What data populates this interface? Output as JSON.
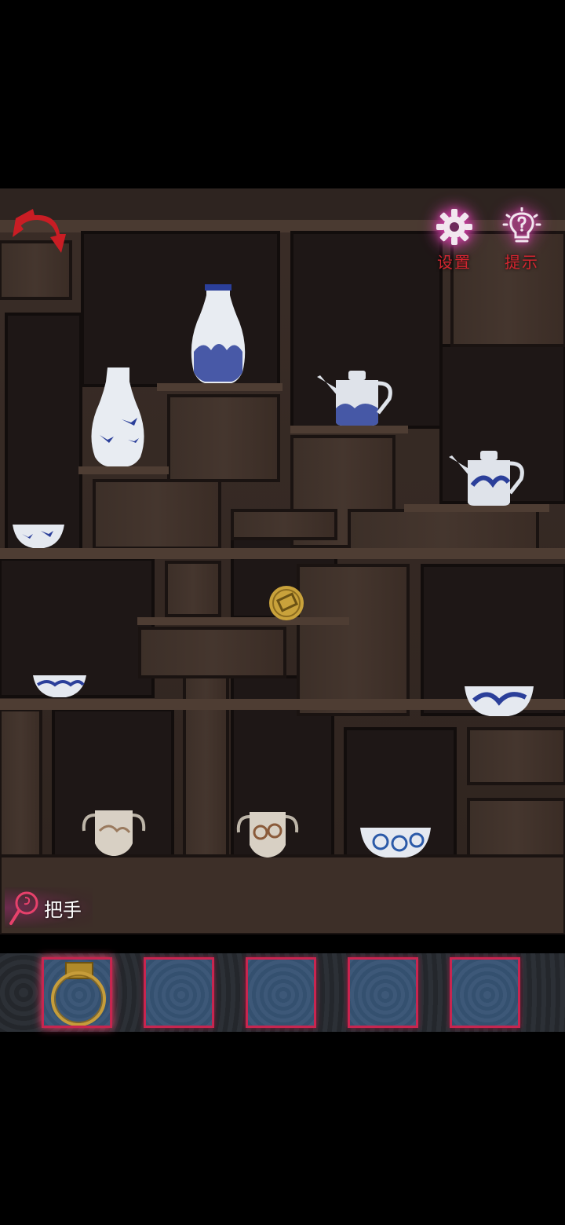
{
  "hud": {
    "settings_label": "设置",
    "hint_label": "提示"
  },
  "selected_item": {
    "name": "把手"
  },
  "inventory": {
    "slots": [
      {
        "item": "handle-ring",
        "selected": true
      },
      {
        "item": null
      },
      {
        "item": null
      },
      {
        "item": null
      },
      {
        "item": null
      }
    ]
  },
  "colors": {
    "accent_red": "#d4252f",
    "glow_pink": "#d84fb3",
    "slot_border": "#c8254f",
    "wood": "#3a2d27",
    "porcelain_blue": "#2b3f9a"
  }
}
